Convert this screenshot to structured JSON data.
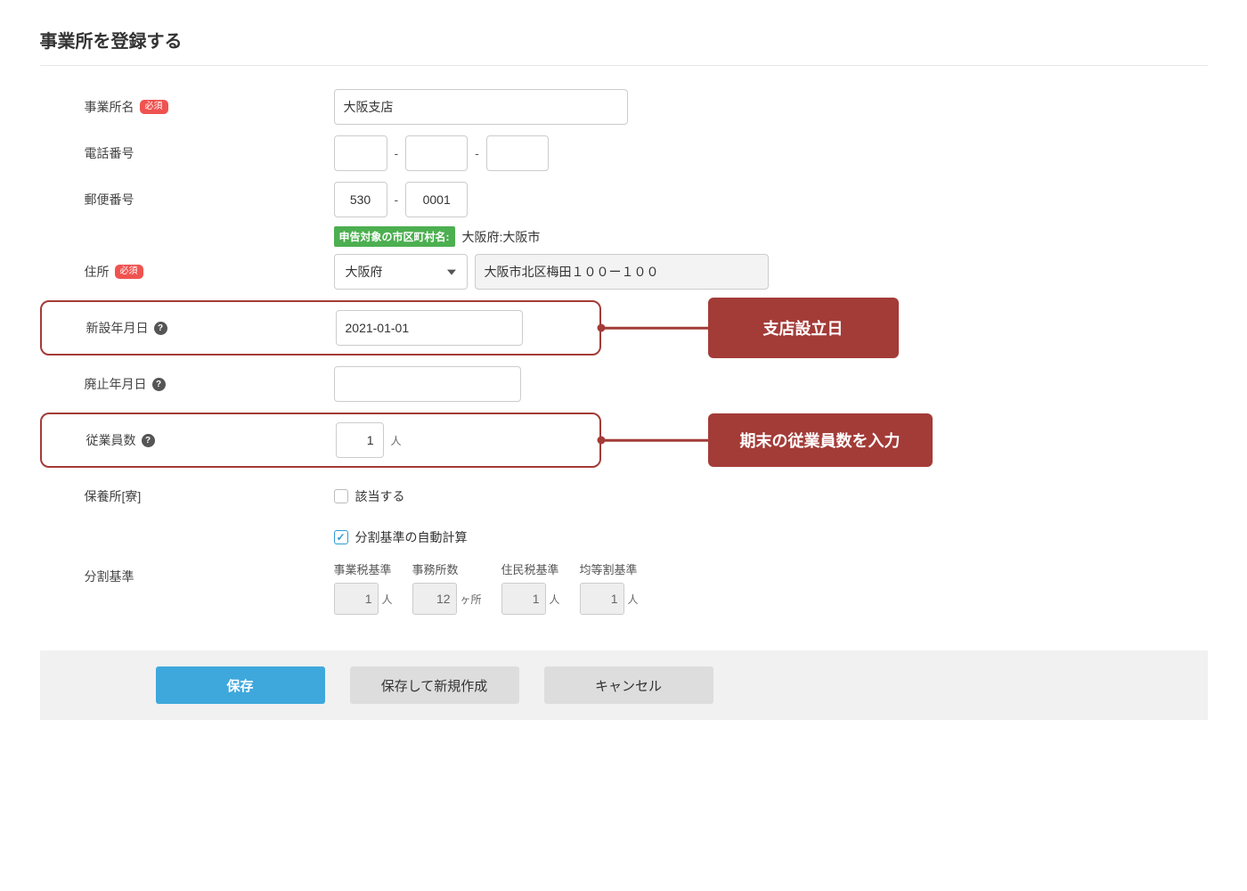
{
  "page_title": "事業所を登録する",
  "labels": {
    "office_name": "事業所名",
    "phone": "電話番号",
    "postal": "郵便番号",
    "address": "住所",
    "est_date": "新設年月日",
    "abo_date": "廃止年月日",
    "employees": "従業員数",
    "dorm": "保養所[寮]",
    "split": "分割基準",
    "required": "必須",
    "autocalc": "分割基準の自動計算",
    "applies": "該当する",
    "muni_tag": "申告対象の市区町村名:",
    "muni_val": "大阪府:大阪市"
  },
  "values": {
    "office_name": "大阪支店",
    "postal1": "530",
    "postal2": "0001",
    "pref": "大阪府",
    "addr_rest": "大阪市北区梅田１００ー１００",
    "est_date": "2021-01-01",
    "employees": "1"
  },
  "split": {
    "headers": {
      "biz": "事業税基準",
      "ofc": "事務所数",
      "res": "住民税基準",
      "eq": "均等割基準"
    },
    "vals": {
      "biz": "1",
      "ofc": "12",
      "res": "1",
      "eq": "1"
    },
    "units": {
      "person": "人",
      "place": "ヶ所"
    }
  },
  "callouts": {
    "est": "支店設立日",
    "emp": "期末の従業員数を入力"
  },
  "buttons": {
    "save": "保存",
    "save_new": "保存して新規作成",
    "cancel": "キャンセル"
  }
}
